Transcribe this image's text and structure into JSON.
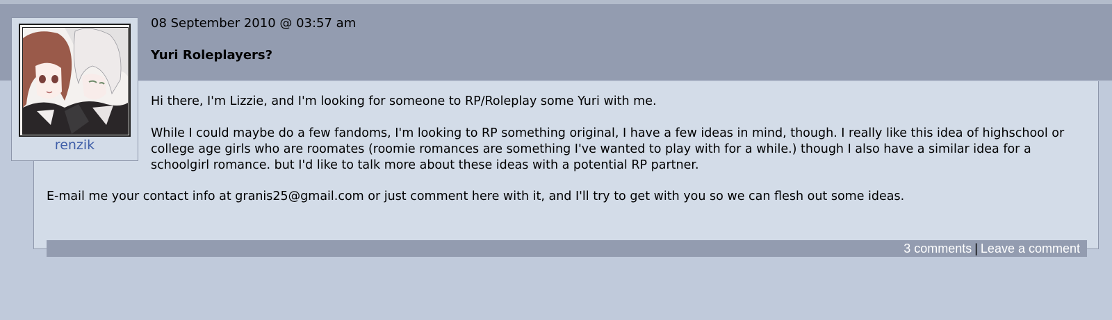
{
  "post": {
    "date": "08 September 2010 @ 03:57 am",
    "subject": "Yuri Roleplayers?",
    "paragraphs": [
      "Hi there, I'm Lizzie, and I'm looking for someone to RP/Roleplay some Yuri with me.",
      "While I could maybe do a few fandoms, I'm looking to RP something original, I have a few ideas in mind, though. I really like this idea of highschool or college age girls who are roomates (roomie romances are something I've wanted to play with for a while.) though I also have a similar idea for a schoolgirl romance. but I'd like to talk more about these ideas with a potential RP partner.",
      "E-mail me your contact info at granis25@gmail.com or just comment here with it, and I'll try to get with you so we can flesh out some ideas."
    ]
  },
  "user": {
    "name": "renzik",
    "userpic": "anime-girls-userpic"
  },
  "footer": {
    "comments_label": "3 comments",
    "separator": "|",
    "leave_comment_label": "Leave a comment"
  }
}
